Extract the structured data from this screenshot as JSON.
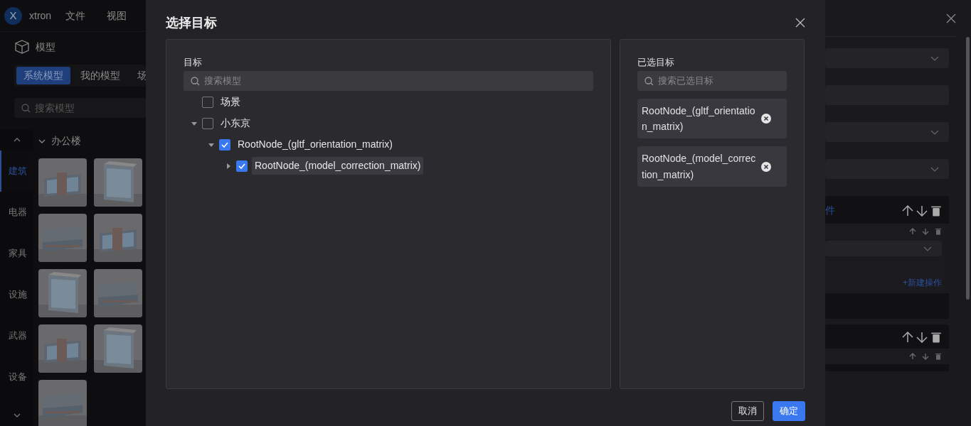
{
  "app": {
    "logo": "X",
    "name": "xtron",
    "menu": [
      {
        "label": "文件"
      },
      {
        "label": "视图"
      }
    ]
  },
  "model_panel": {
    "title": "模型",
    "tabs": [
      {
        "label": "系统模型",
        "selected": true
      },
      {
        "label": "我的模型",
        "selected": false
      },
      {
        "label": "场",
        "selected": false
      }
    ],
    "search": {
      "placeholder": "搜索模型"
    },
    "categories": [
      {
        "label": "建筑",
        "selected": true
      },
      {
        "label": "电器",
        "selected": false
      },
      {
        "label": "家具",
        "selected": false
      },
      {
        "label": "设施",
        "selected": false
      },
      {
        "label": "武器",
        "selected": false
      },
      {
        "label": "设备",
        "selected": false
      }
    ],
    "group": {
      "title": "办公楼",
      "expanded": true
    }
  },
  "property_panel": {
    "fields": [
      {
        "kind": "select"
      },
      {
        "kind": "input"
      },
      {
        "kind": "select"
      },
      {
        "kind": "select"
      }
    ],
    "cards": [
      {
        "kind": "card",
        "link": "件",
        "inner": [
          {
            "kind": "select"
          }
        ],
        "add_action": "+新建操作"
      },
      {
        "kind": "card"
      }
    ]
  },
  "dialog": {
    "title": "选择目标",
    "targets": {
      "label": "目标",
      "search": {
        "placeholder": "搜索模型"
      },
      "tree": [
        {
          "label": "场景",
          "checked": false,
          "selected": false
        },
        {
          "label": "小东京",
          "checked": false,
          "selected": false,
          "expanded": true,
          "children": [
            {
              "label": "RootNode_(gltf_orientation_matrix)",
              "checked": true,
              "selected": false,
              "expanded": true,
              "children": [
                {
                  "label": "RootNode_(model_correction_matrix)",
                  "checked": true,
                  "selected": true,
                  "expanded": false
                }
              ]
            }
          ]
        }
      ]
    },
    "selected_targets": {
      "label": "已选目标",
      "search": {
        "placeholder": "搜索已选目标"
      },
      "items": [
        {
          "label": "RootNode_(gltf_orientation_matrix)"
        },
        {
          "label": "RootNode_(model_correction_matrix)"
        }
      ]
    },
    "buttons": [
      {
        "label": "取消",
        "kind": "secondary"
      },
      {
        "label": "确定",
        "kind": "primary"
      }
    ]
  }
}
